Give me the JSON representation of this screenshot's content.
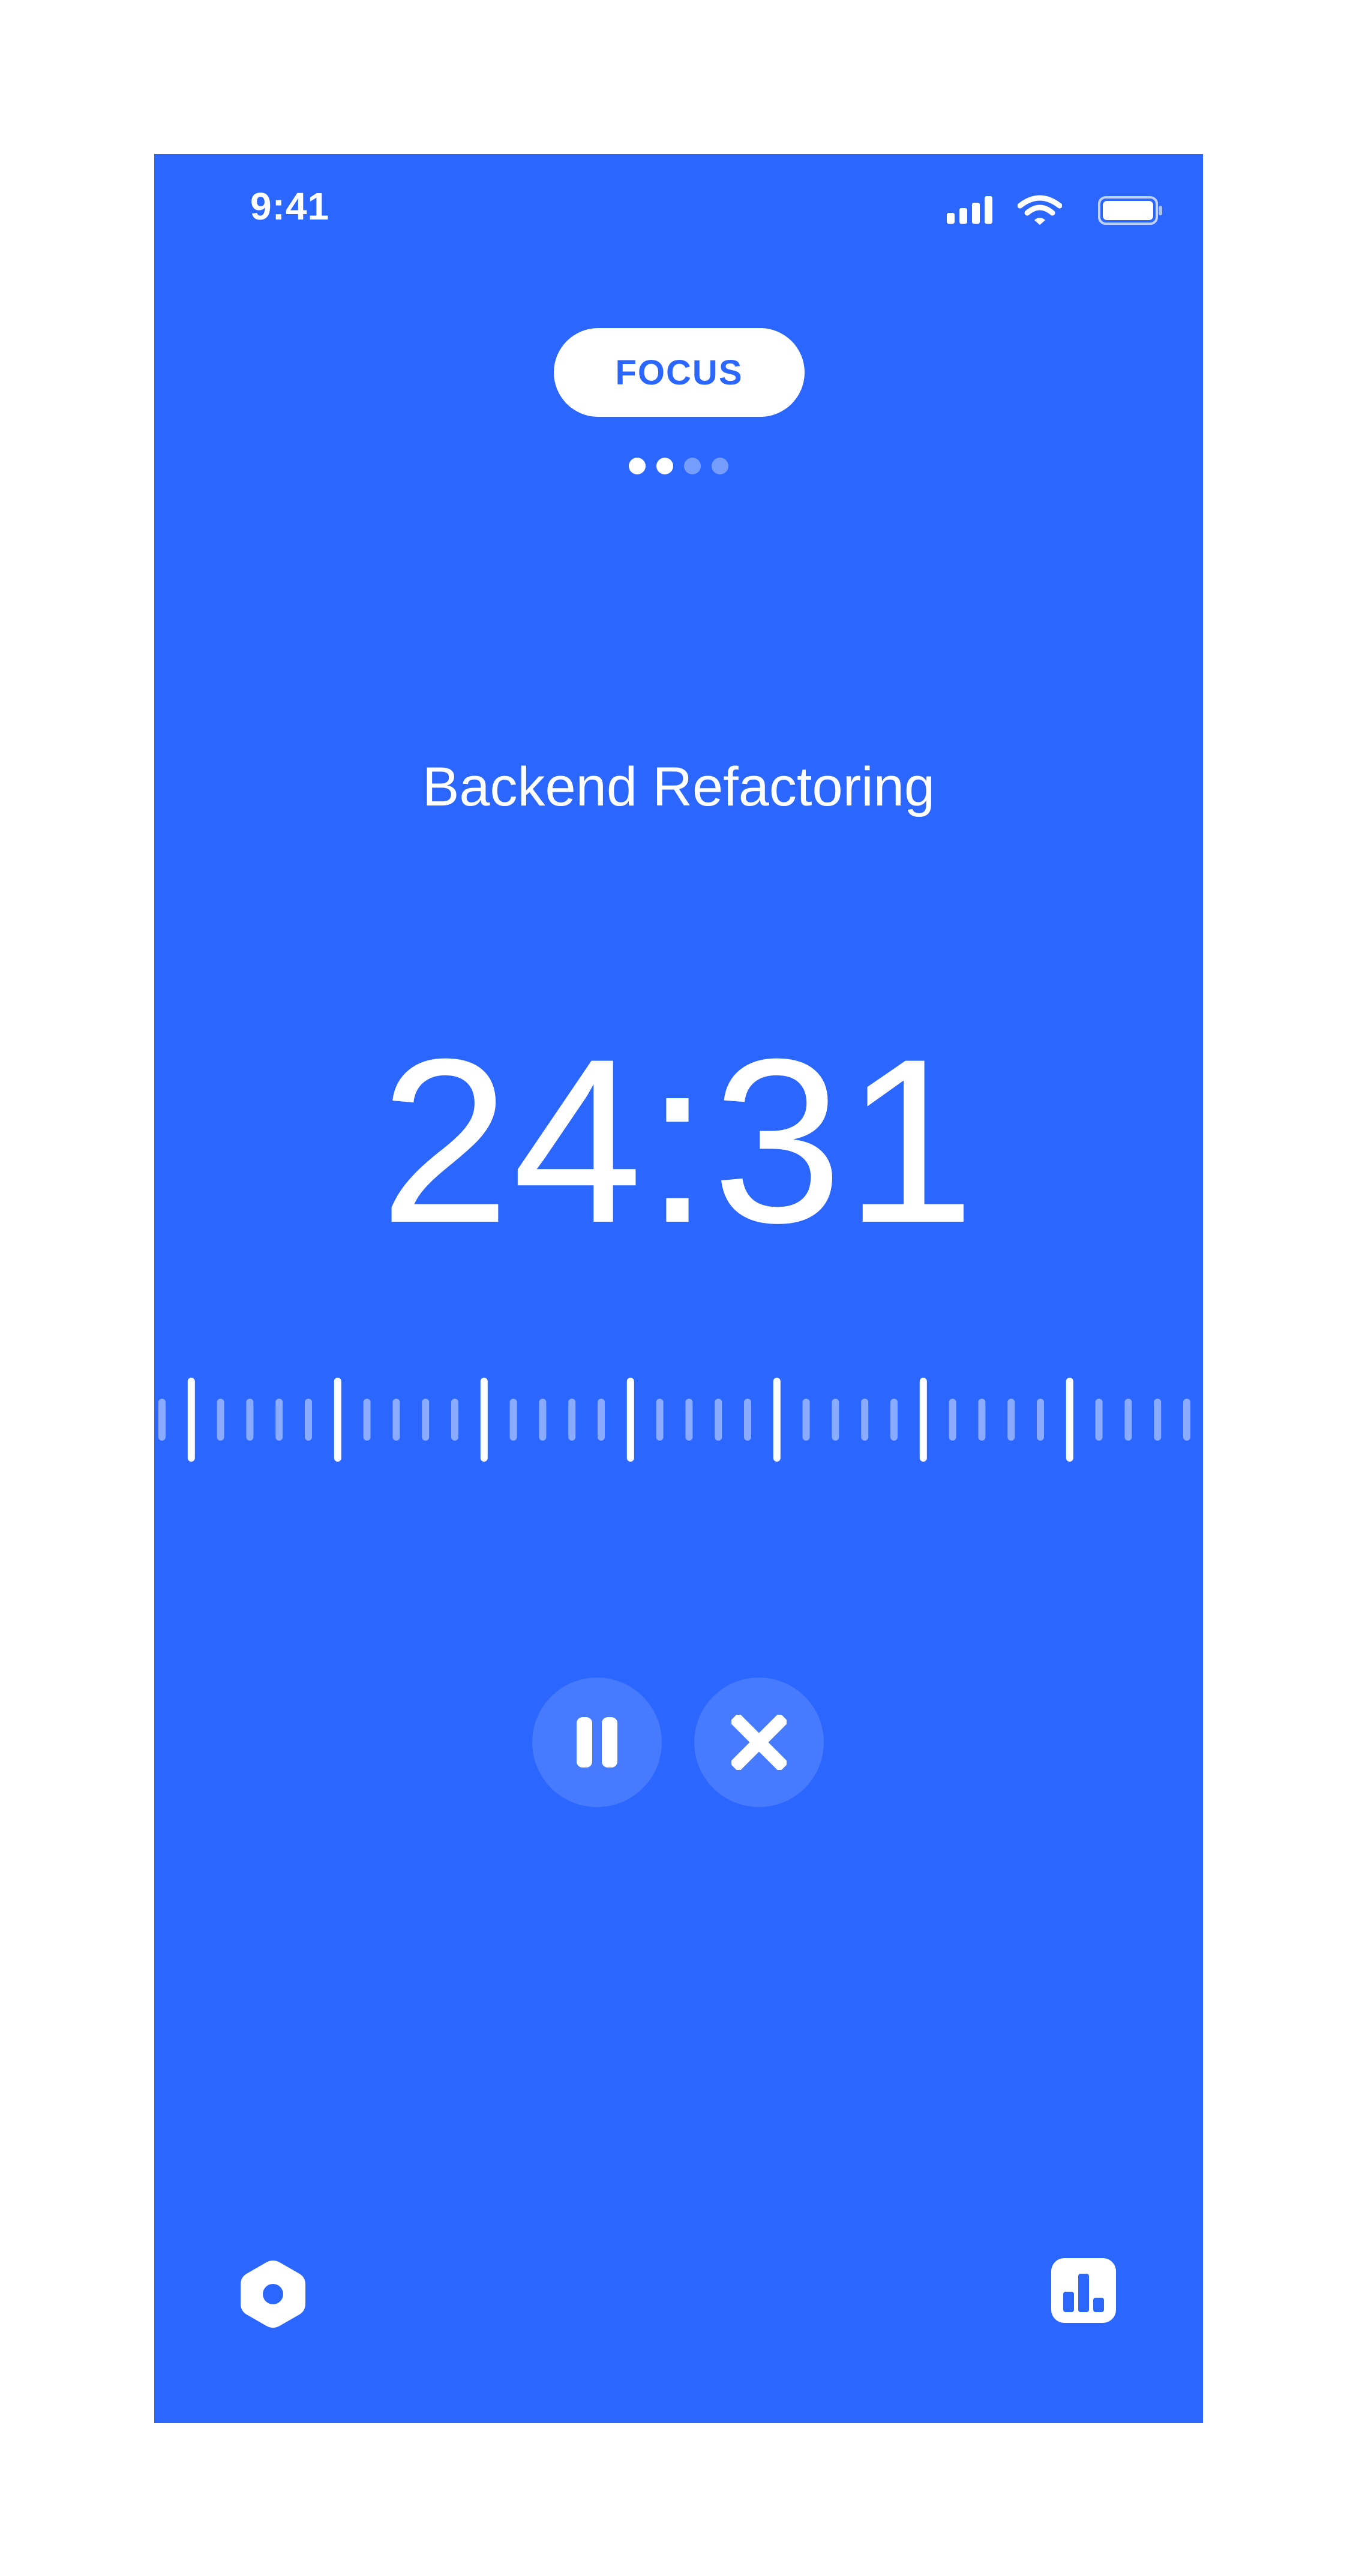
{
  "status_bar": {
    "time": "9:41",
    "icons": [
      "cellular-signal-icon",
      "wifi-icon",
      "battery-icon"
    ]
  },
  "mode": {
    "label": "FOCUS",
    "pages_total": 4,
    "pages_highlighted": 2
  },
  "session": {
    "task": "Backend Refactoring",
    "time_remaining": "24:31"
  },
  "controls": {
    "pause": "pause-icon",
    "cancel": "close-icon"
  },
  "bottom_bar": {
    "left": "settings-icon",
    "right": "stats-icon"
  },
  "colors": {
    "background": "#2b67ff",
    "foreground": "#ffffff"
  }
}
